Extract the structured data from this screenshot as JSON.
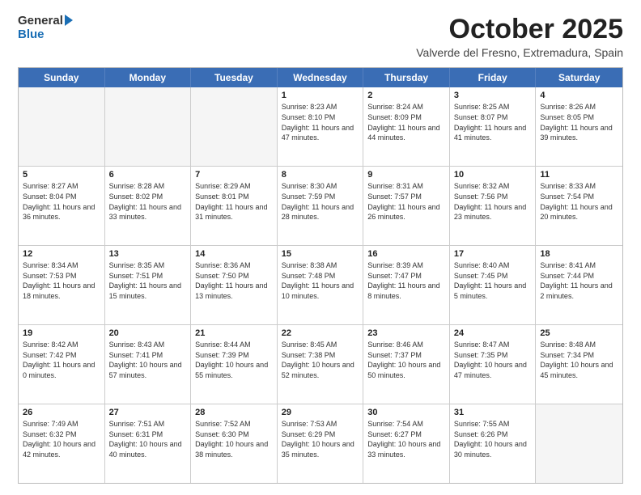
{
  "logo": {
    "general": "General",
    "blue": "Blue"
  },
  "title": {
    "month": "October 2025",
    "location": "Valverde del Fresno, Extremadura, Spain"
  },
  "days_of_week": [
    "Sunday",
    "Monday",
    "Tuesday",
    "Wednesday",
    "Thursday",
    "Friday",
    "Saturday"
  ],
  "rows": [
    [
      {
        "day": "",
        "info": "",
        "empty": true
      },
      {
        "day": "",
        "info": "",
        "empty": true
      },
      {
        "day": "",
        "info": "",
        "empty": true
      },
      {
        "day": "1",
        "info": "Sunrise: 8:23 AM\nSunset: 8:10 PM\nDaylight: 11 hours and 47 minutes.",
        "empty": false
      },
      {
        "day": "2",
        "info": "Sunrise: 8:24 AM\nSunset: 8:09 PM\nDaylight: 11 hours and 44 minutes.",
        "empty": false
      },
      {
        "day": "3",
        "info": "Sunrise: 8:25 AM\nSunset: 8:07 PM\nDaylight: 11 hours and 41 minutes.",
        "empty": false
      },
      {
        "day": "4",
        "info": "Sunrise: 8:26 AM\nSunset: 8:05 PM\nDaylight: 11 hours and 39 minutes.",
        "empty": false
      }
    ],
    [
      {
        "day": "5",
        "info": "Sunrise: 8:27 AM\nSunset: 8:04 PM\nDaylight: 11 hours and 36 minutes.",
        "empty": false
      },
      {
        "day": "6",
        "info": "Sunrise: 8:28 AM\nSunset: 8:02 PM\nDaylight: 11 hours and 33 minutes.",
        "empty": false
      },
      {
        "day": "7",
        "info": "Sunrise: 8:29 AM\nSunset: 8:01 PM\nDaylight: 11 hours and 31 minutes.",
        "empty": false
      },
      {
        "day": "8",
        "info": "Sunrise: 8:30 AM\nSunset: 7:59 PM\nDaylight: 11 hours and 28 minutes.",
        "empty": false
      },
      {
        "day": "9",
        "info": "Sunrise: 8:31 AM\nSunset: 7:57 PM\nDaylight: 11 hours and 26 minutes.",
        "empty": false
      },
      {
        "day": "10",
        "info": "Sunrise: 8:32 AM\nSunset: 7:56 PM\nDaylight: 11 hours and 23 minutes.",
        "empty": false
      },
      {
        "day": "11",
        "info": "Sunrise: 8:33 AM\nSunset: 7:54 PM\nDaylight: 11 hours and 20 minutes.",
        "empty": false
      }
    ],
    [
      {
        "day": "12",
        "info": "Sunrise: 8:34 AM\nSunset: 7:53 PM\nDaylight: 11 hours and 18 minutes.",
        "empty": false
      },
      {
        "day": "13",
        "info": "Sunrise: 8:35 AM\nSunset: 7:51 PM\nDaylight: 11 hours and 15 minutes.",
        "empty": false
      },
      {
        "day": "14",
        "info": "Sunrise: 8:36 AM\nSunset: 7:50 PM\nDaylight: 11 hours and 13 minutes.",
        "empty": false
      },
      {
        "day": "15",
        "info": "Sunrise: 8:38 AM\nSunset: 7:48 PM\nDaylight: 11 hours and 10 minutes.",
        "empty": false
      },
      {
        "day": "16",
        "info": "Sunrise: 8:39 AM\nSunset: 7:47 PM\nDaylight: 11 hours and 8 minutes.",
        "empty": false
      },
      {
        "day": "17",
        "info": "Sunrise: 8:40 AM\nSunset: 7:45 PM\nDaylight: 11 hours and 5 minutes.",
        "empty": false
      },
      {
        "day": "18",
        "info": "Sunrise: 8:41 AM\nSunset: 7:44 PM\nDaylight: 11 hours and 2 minutes.",
        "empty": false
      }
    ],
    [
      {
        "day": "19",
        "info": "Sunrise: 8:42 AM\nSunset: 7:42 PM\nDaylight: 11 hours and 0 minutes.",
        "empty": false
      },
      {
        "day": "20",
        "info": "Sunrise: 8:43 AM\nSunset: 7:41 PM\nDaylight: 10 hours and 57 minutes.",
        "empty": false
      },
      {
        "day": "21",
        "info": "Sunrise: 8:44 AM\nSunset: 7:39 PM\nDaylight: 10 hours and 55 minutes.",
        "empty": false
      },
      {
        "day": "22",
        "info": "Sunrise: 8:45 AM\nSunset: 7:38 PM\nDaylight: 10 hours and 52 minutes.",
        "empty": false
      },
      {
        "day": "23",
        "info": "Sunrise: 8:46 AM\nSunset: 7:37 PM\nDaylight: 10 hours and 50 minutes.",
        "empty": false
      },
      {
        "day": "24",
        "info": "Sunrise: 8:47 AM\nSunset: 7:35 PM\nDaylight: 10 hours and 47 minutes.",
        "empty": false
      },
      {
        "day": "25",
        "info": "Sunrise: 8:48 AM\nSunset: 7:34 PM\nDaylight: 10 hours and 45 minutes.",
        "empty": false
      }
    ],
    [
      {
        "day": "26",
        "info": "Sunrise: 7:49 AM\nSunset: 6:32 PM\nDaylight: 10 hours and 42 minutes.",
        "empty": false
      },
      {
        "day": "27",
        "info": "Sunrise: 7:51 AM\nSunset: 6:31 PM\nDaylight: 10 hours and 40 minutes.",
        "empty": false
      },
      {
        "day": "28",
        "info": "Sunrise: 7:52 AM\nSunset: 6:30 PM\nDaylight: 10 hours and 38 minutes.",
        "empty": false
      },
      {
        "day": "29",
        "info": "Sunrise: 7:53 AM\nSunset: 6:29 PM\nDaylight: 10 hours and 35 minutes.",
        "empty": false
      },
      {
        "day": "30",
        "info": "Sunrise: 7:54 AM\nSunset: 6:27 PM\nDaylight: 10 hours and 33 minutes.",
        "empty": false
      },
      {
        "day": "31",
        "info": "Sunrise: 7:55 AM\nSunset: 6:26 PM\nDaylight: 10 hours and 30 minutes.",
        "empty": false
      },
      {
        "day": "",
        "info": "",
        "empty": true
      }
    ]
  ]
}
